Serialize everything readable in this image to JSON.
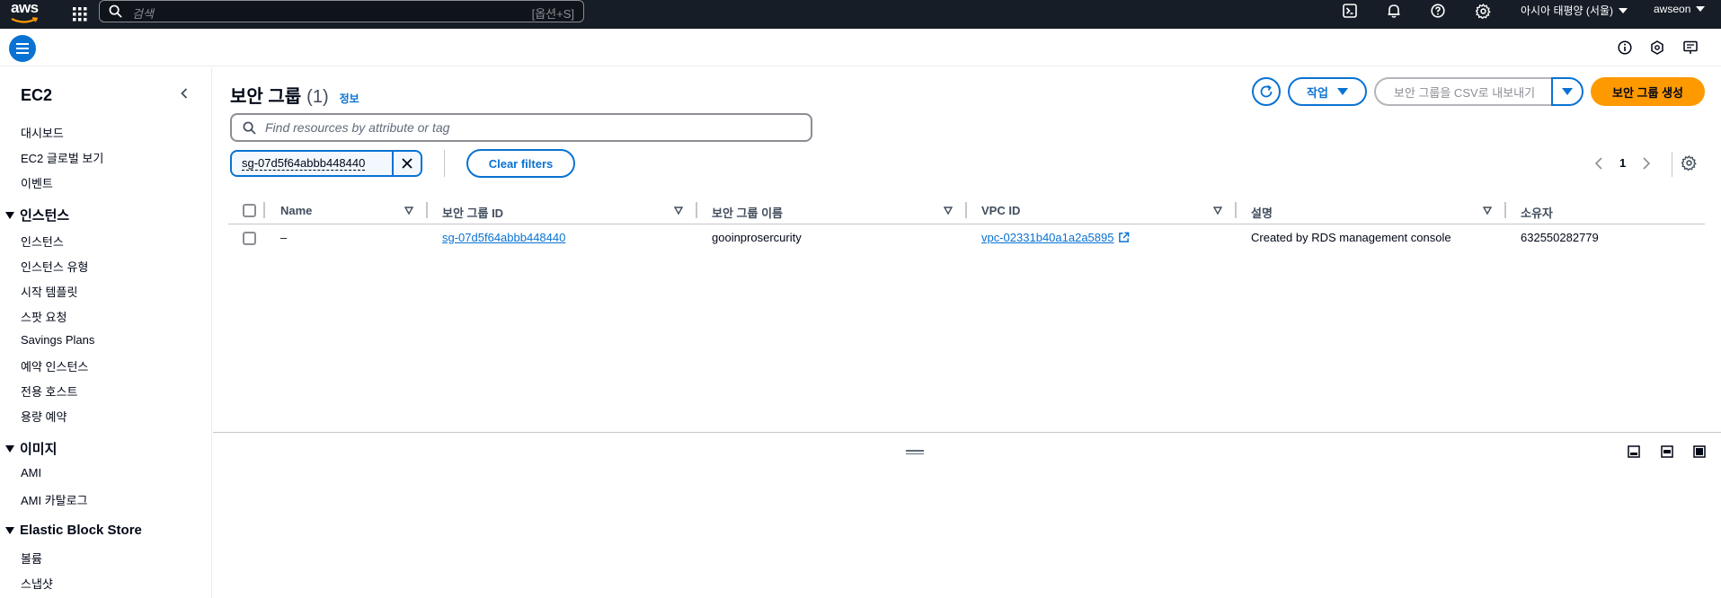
{
  "topnav": {
    "logo": "aws",
    "search_placeholder": "검색",
    "search_shortcut": "[옵션+S]",
    "region": "아시아 태평양 (서울)",
    "account": "awseon"
  },
  "sidebar": {
    "title": "EC2",
    "top_links": [
      "대시보드",
      "EC2 글로벌 보기",
      "이벤트"
    ],
    "sections": [
      {
        "title": "인스턴스",
        "items": [
          "인스턴스",
          "인스턴스 유형",
          "시작 템플릿",
          "스팟 요청",
          "Savings Plans",
          "예약 인스턴스",
          "전용 호스트",
          "용량 예약"
        ]
      },
      {
        "title": "이미지",
        "items": [
          "AMI",
          "AMI 카탈로그"
        ]
      },
      {
        "title": "Elastic Block Store",
        "items": [
          "볼륨",
          "스냅샷"
        ]
      }
    ]
  },
  "header": {
    "title": "보안 그룹",
    "count": "(1)",
    "info": "정보",
    "actions_label": "작업",
    "export_label": "보안 그룹을 CSV로 내보내기",
    "create_label": "보안 그룹 생성"
  },
  "filter": {
    "placeholder": "Find resources by attribute or tag",
    "token": "sg-07d5f64abbb448440",
    "clear_label": "Clear filters"
  },
  "pagination": {
    "page": "1"
  },
  "table": {
    "columns": [
      "Name",
      "보안 그룹 ID",
      "보안 그룹 이름",
      "VPC ID",
      "설명",
      "소유자"
    ],
    "rows": [
      {
        "name": "–",
        "sg_id": "sg-07d5f64abbb448440",
        "sg_name": "gooinprosercurity",
        "vpc_id": "vpc-02331b40a1a2a5895",
        "description": "Created by RDS management console",
        "owner": "632550282779"
      }
    ]
  },
  "colors": {
    "accent": "#0972d3",
    "primary": "#ff9900",
    "nav_bg": "#161d26"
  }
}
